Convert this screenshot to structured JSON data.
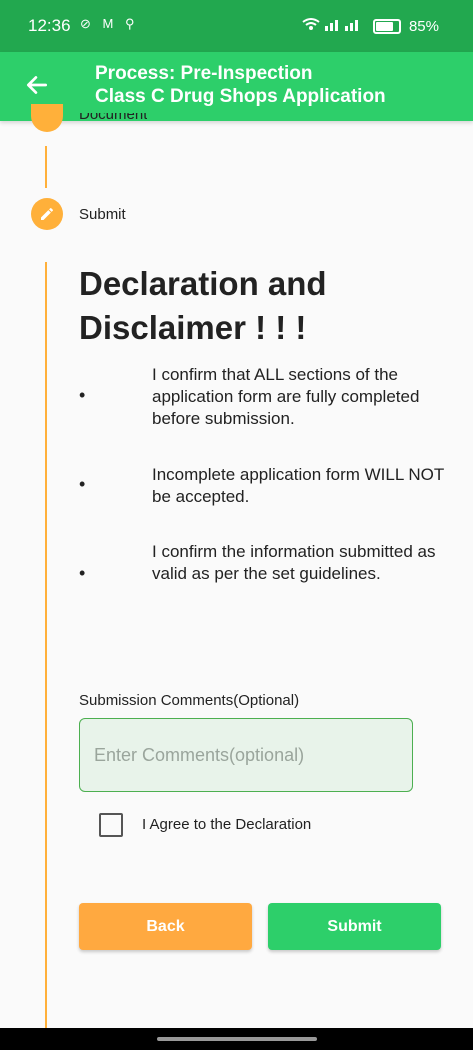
{
  "status_bar": {
    "time": "12:36",
    "notification_icons": "⊘ M ⚲",
    "battery": "85%"
  },
  "app_bar": {
    "title_line1": "Process: Pre-Inspection",
    "title_line2": "Class C Drug Shops Application"
  },
  "steps": {
    "previous_label": "Document",
    "current_label": "Submit"
  },
  "declaration": {
    "heading": "Declaration and Disclaimer ! ! !",
    "bullets": [
      "I confirm that ALL sections of the application form are fully completed before submission.",
      "Incomplete application form WILL NOT be accepted.",
      "I confirm the information submitted as valid as per the set guidelines."
    ]
  },
  "comments": {
    "label": "Submission Comments(Optional)",
    "placeholder": "Enter Comments(optional)",
    "value": ""
  },
  "agree": {
    "label": "I Agree to the Declaration",
    "checked": false
  },
  "buttons": {
    "back": "Back",
    "submit": "Submit"
  },
  "colors": {
    "status_bar": "#22a84f",
    "app_bar": "#2dcf6a",
    "accent_orange": "#ffa940",
    "submit_green": "#2dcf6a"
  }
}
